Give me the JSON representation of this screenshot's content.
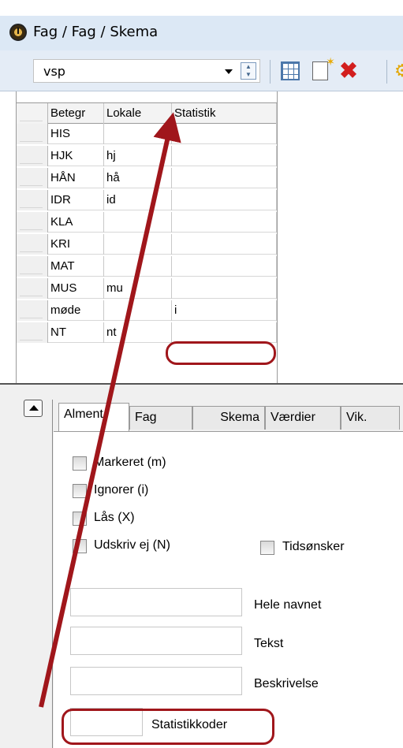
{
  "window": {
    "title": "Fag / Fag / Skema",
    "icon": "clock-icon"
  },
  "toolbar": {
    "combo_value": "vsp",
    "buttons": [
      "grid-settings-icon",
      "new-record-icon",
      "delete-icon",
      "gear-icon"
    ]
  },
  "grid": {
    "columns": [
      "Betegr",
      "Lokale",
      "Statistik"
    ],
    "rows": [
      [
        "HIS",
        "",
        ""
      ],
      [
        "HJK",
        "hj",
        ""
      ],
      [
        "HÅN",
        "hå",
        ""
      ],
      [
        "IDR",
        "id",
        ""
      ],
      [
        "KLA",
        "",
        ""
      ],
      [
        "KRI",
        "",
        ""
      ],
      [
        "MAT",
        "",
        ""
      ],
      [
        "MUS",
        "mu",
        ""
      ],
      [
        "møde",
        "",
        "i"
      ],
      [
        "NT",
        "nt",
        ""
      ]
    ]
  },
  "panel": {
    "tabs": [
      "Alment",
      "Fag",
      "Skema",
      "Værdier",
      "Vik."
    ],
    "active_tab": "Alment",
    "checkboxes": [
      {
        "label": "Markeret (m)",
        "checked": false
      },
      {
        "label": "Ignorer (i)",
        "checked": false
      },
      {
        "label": "Lås (X)",
        "checked": false
      },
      {
        "label": "Udskriv ej (N)",
        "checked": false
      },
      {
        "label": "Tidsønsker",
        "checked": false
      }
    ],
    "fields": [
      {
        "label": "Hele navnet",
        "value": ""
      },
      {
        "label": "Tekst",
        "value": ""
      },
      {
        "label": "Beskrivelse",
        "value": ""
      },
      {
        "label": "Statistikkoder",
        "value": ""
      }
    ]
  },
  "annotations": {
    "highlight_color": "#a0161b"
  }
}
